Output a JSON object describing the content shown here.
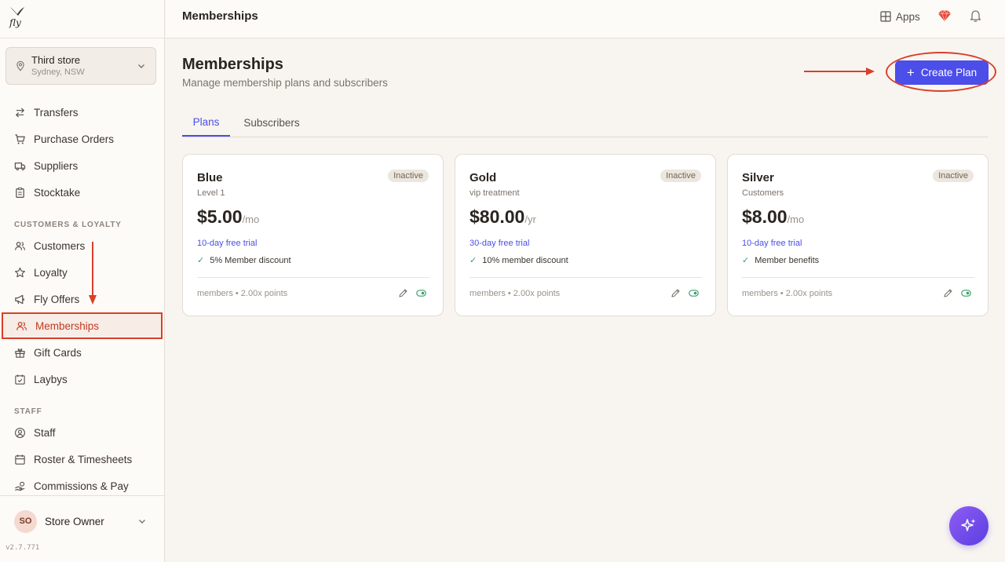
{
  "colors": {
    "accent": "#4b4ee8",
    "annotation": "#d8402a",
    "active_nav": "#c23a22",
    "success": "#3aa06a"
  },
  "store": {
    "name": "Third store",
    "location": "Sydney, NSW"
  },
  "sidebar": {
    "items_top": [
      {
        "label": "Transfers",
        "icon": "transfer-arrows-icon"
      },
      {
        "label": "Purchase Orders",
        "icon": "cart-icon"
      },
      {
        "label": "Suppliers",
        "icon": "truck-icon"
      },
      {
        "label": "Stocktake",
        "icon": "clipboard-icon"
      }
    ],
    "section_customers": "CUSTOMERS & LOYALTY",
    "items_customers": [
      {
        "label": "Customers",
        "icon": "users-icon"
      },
      {
        "label": "Loyalty",
        "icon": "star-icon"
      },
      {
        "label": "Fly Offers",
        "icon": "megaphone-icon"
      },
      {
        "label": "Memberships",
        "icon": "users-icon",
        "active": true
      },
      {
        "label": "Gift Cards",
        "icon": "gift-icon"
      },
      {
        "label": "Laybys",
        "icon": "calendar-check-icon"
      }
    ],
    "section_staff": "STAFF",
    "items_staff": [
      {
        "label": "Staff",
        "icon": "user-circle-icon"
      },
      {
        "label": "Roster & Timesheets",
        "icon": "calendar-icon"
      },
      {
        "label": "Commissions & Pay",
        "icon": "coins-icon"
      }
    ]
  },
  "user": {
    "initials": "SO",
    "name": "Store Owner"
  },
  "version": "v2.7.771",
  "topbar": {
    "title": "Memberships",
    "apps_label": "Apps"
  },
  "page": {
    "title": "Memberships",
    "subtitle": "Manage membership plans and subscribers",
    "create_label": "Create Plan"
  },
  "tabs": [
    {
      "label": "Plans",
      "active": true
    },
    {
      "label": "Subscribers",
      "active": false
    }
  ],
  "plans": [
    {
      "name": "Blue",
      "desc": "Level 1",
      "status": "Inactive",
      "price": "$5.00",
      "period": "/mo",
      "trial": "10-day free trial",
      "benefit": "5% Member discount",
      "footer": "members • 2.00x points"
    },
    {
      "name": "Gold",
      "desc": "vip treatment",
      "status": "Inactive",
      "price": "$80.00",
      "period": "/yr",
      "trial": "30-day free trial",
      "benefit": "10% member discount",
      "footer": "members • 2.00x points"
    },
    {
      "name": "Silver",
      "desc": "Customers",
      "status": "Inactive",
      "price": "$8.00",
      "period": "/mo",
      "trial": "10-day free trial",
      "benefit": "Member benefits",
      "footer": "members • 2.00x points"
    }
  ]
}
